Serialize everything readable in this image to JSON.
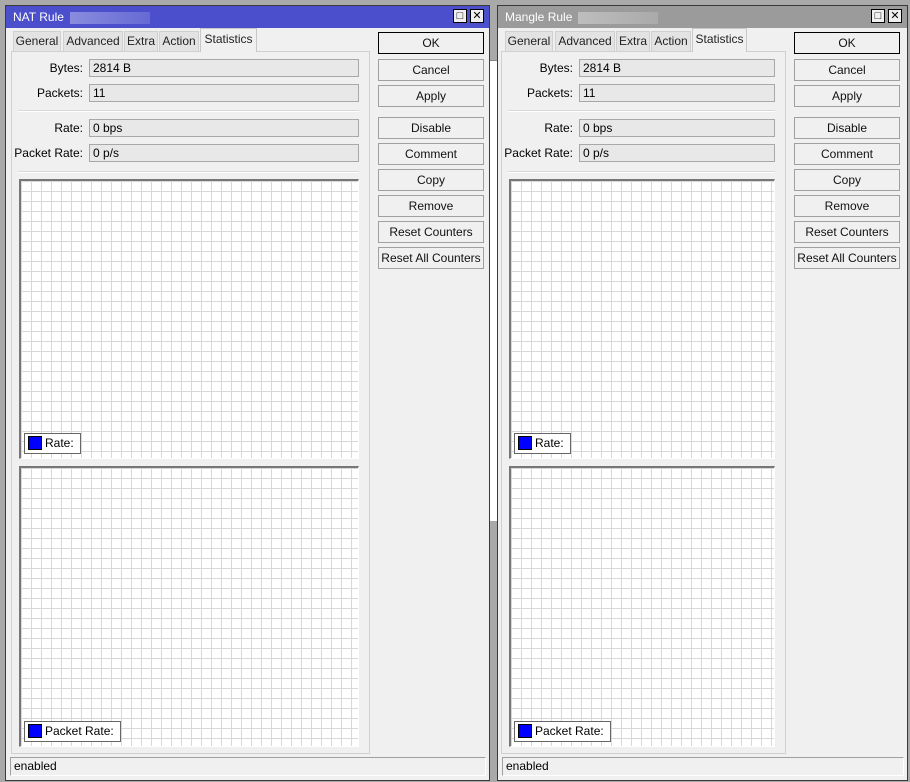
{
  "windows": [
    {
      "title": "NAT Rule",
      "active": true,
      "titlebar_color": "#4b4fcc",
      "tabs": [
        "General",
        "Advanced",
        "Extra",
        "Action",
        "Statistics"
      ],
      "active_tab": "Statistics",
      "fields": [
        {
          "label": "Bytes:",
          "value": "2814 B"
        },
        {
          "label": "Packets:",
          "value": "11"
        },
        {
          "label": "Rate:",
          "value": "0 bps"
        },
        {
          "label": "Packet Rate:",
          "value": "0 p/s"
        }
      ],
      "graphs": [
        {
          "legend": "Rate:",
          "color": "#0000ff"
        },
        {
          "legend": "Packet Rate:",
          "color": "#0000ff"
        }
      ],
      "buttons": [
        "OK",
        "Cancel",
        "Apply",
        "Disable",
        "Comment",
        "Copy",
        "Remove",
        "Reset Counters",
        "Reset All Counters"
      ],
      "status": "enabled"
    },
    {
      "title": "Mangle Rule",
      "active": false,
      "titlebar_color": "#9b9b9b",
      "tabs": [
        "General",
        "Advanced",
        "Extra",
        "Action",
        "Statistics"
      ],
      "active_tab": "Statistics",
      "fields": [
        {
          "label": "Bytes:",
          "value": "2814 B"
        },
        {
          "label": "Packets:",
          "value": "11"
        },
        {
          "label": "Rate:",
          "value": "0 bps"
        },
        {
          "label": "Packet Rate:",
          "value": "0 p/s"
        }
      ],
      "graphs": [
        {
          "legend": "Rate:",
          "color": "#0000ff"
        },
        {
          "legend": "Packet Rate:",
          "color": "#0000ff"
        }
      ],
      "buttons": [
        "OK",
        "Cancel",
        "Apply",
        "Disable",
        "Comment",
        "Copy",
        "Remove",
        "Reset Counters",
        "Reset All Counters"
      ],
      "status": "enabled"
    }
  ],
  "titlebar_buttons": {
    "maximize": "□",
    "close": "✕"
  }
}
